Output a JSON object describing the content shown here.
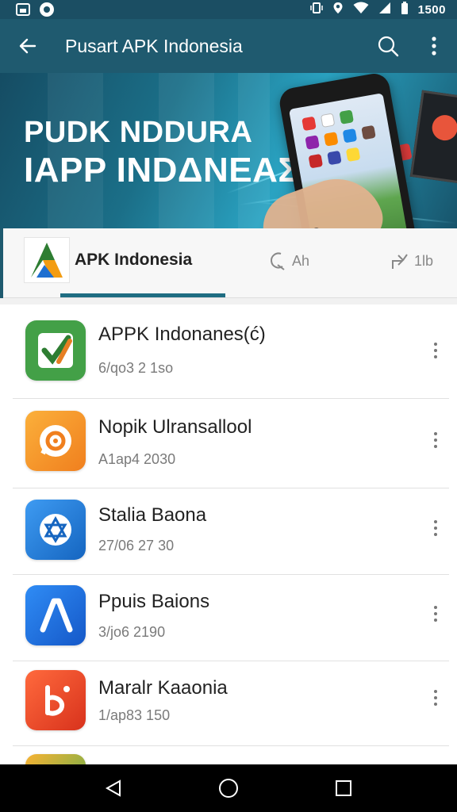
{
  "status_bar": {
    "time": "1500",
    "left_icons": [
      "image-icon",
      "circle-app-icon"
    ],
    "right_icons": [
      "vibrate-icon",
      "location-icon",
      "wifi-icon",
      "signal-icon",
      "battery-icon"
    ]
  },
  "app_bar": {
    "title": "Pusart APK Indonesia",
    "back_icon": "arrow-left-icon",
    "search_icon": "search-icon",
    "more_icon": "more-vert-icon"
  },
  "banner": {
    "line1": "PUDK NDDURA",
    "line2": "IAPP INDΔNEAΣIA"
  },
  "tabs": {
    "main_label": "APK Indonesia",
    "items": [
      {
        "label": "Ah",
        "icon": "refresh-icon"
      },
      {
        "label": "1lb",
        "icon": "share-icon"
      }
    ]
  },
  "apps": [
    {
      "name": "APPK Indonanes(ć)",
      "meta": "6/qo3 2 1so",
      "icon": "check-edit-icon",
      "color": "#4caf50"
    },
    {
      "name": "Nopik Ulransallool",
      "meta": "A1ap4 2030",
      "icon": "chat-swirl-icon",
      "color": "#f59a23"
    },
    {
      "name": "Stalia Baona",
      "meta": "27/06 27 30",
      "icon": "star-map-icon",
      "color": "#1e7fe0"
    },
    {
      "name": "Ppuis Baions",
      "meta": "3/jo6 2190",
      "icon": "a-letter-icon",
      "color": "#1b73e6"
    },
    {
      "name": "Maralr Kaaonia",
      "meta": "1/ap83 150",
      "icon": "b-swirl-icon",
      "color": "#ef4b2c"
    }
  ],
  "nav": {
    "back": "nav-back-icon",
    "home": "nav-home-icon",
    "recents": "nav-recents-icon"
  }
}
